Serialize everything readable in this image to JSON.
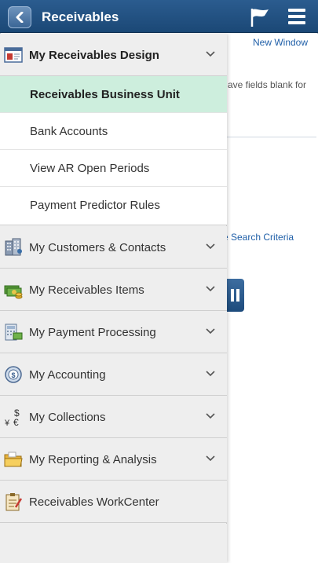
{
  "header": {
    "title": "Receivables",
    "back_icon": "chevron-left-icon",
    "flag_icon": "flag-icon",
    "menu_icon": "hamburger-menu-icon",
    "bar_color": "#1f4d7e"
  },
  "background": {
    "new_window": "New Window",
    "hint_text": "ave fields blank for",
    "search_criteria": "e Search Criteria"
  },
  "nav": {
    "groups": [
      {
        "label": "My Receivables Design",
        "icon": "design-window-icon",
        "expanded": true
      },
      {
        "label": "My Customers & Contacts",
        "icon": "customers-building-icon",
        "expanded": false
      },
      {
        "label": "My Receivables Items",
        "icon": "money-stack-icon",
        "expanded": false
      },
      {
        "label": "My Payment Processing",
        "icon": "payment-calculator-icon",
        "expanded": false
      },
      {
        "label": "My Accounting",
        "icon": "accounting-globe-icon",
        "expanded": false
      },
      {
        "label": "My Collections",
        "icon": "currency-symbols-icon",
        "expanded": false
      },
      {
        "label": "My Reporting & Analysis",
        "icon": "folder-icon",
        "expanded": false
      },
      {
        "label": "Receivables WorkCenter",
        "icon": "workcenter-clipboard-icon",
        "expanded": false
      }
    ],
    "design_items": [
      {
        "label": "Receivables Business Unit",
        "active": true
      },
      {
        "label": "Bank Accounts",
        "active": false
      },
      {
        "label": "View AR Open Periods",
        "active": false
      },
      {
        "label": "Payment Predictor Rules",
        "active": false
      }
    ],
    "active_color": "#cdeedd"
  }
}
